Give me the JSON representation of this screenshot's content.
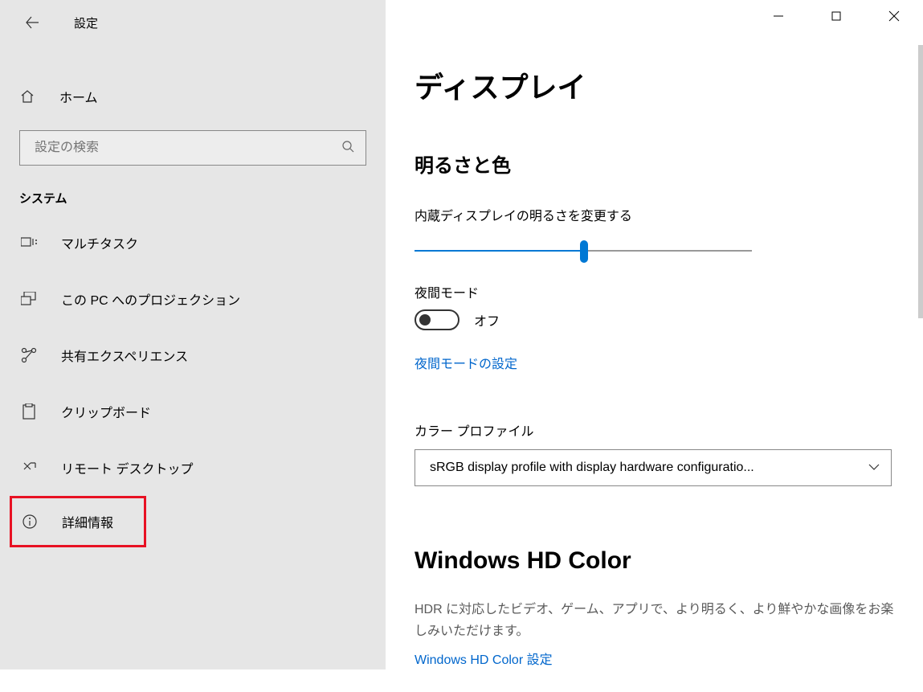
{
  "app_title": "設定",
  "home_label": "ホーム",
  "search_placeholder": "設定の検索",
  "section_label": "システム",
  "nav": {
    "multitask": "マルチタスク",
    "projection": "この PC へのプロジェクション",
    "shared": "共有エクスペリエンス",
    "clipboard": "クリップボード",
    "remote": "リモート デスクトップ",
    "about": "詳細情報"
  },
  "main": {
    "title": "ディスプレイ",
    "brightness_section": "明るさと色",
    "brightness_label": "内蔵ディスプレイの明るさを変更する",
    "night_mode_label": "夜間モード",
    "night_mode_state": "オフ",
    "night_mode_link": "夜間モードの設定",
    "color_profile_label": "カラー プロファイル",
    "color_profile_value": "sRGB display profile with display hardware configuratio...",
    "hd_title": "Windows HD Color",
    "hd_desc": "HDR に対応したビデオ、ゲーム、アプリで、より明るく、より鮮やかな画像をお楽しみいただけます。",
    "hd_link": "Windows HD Color 設定"
  }
}
